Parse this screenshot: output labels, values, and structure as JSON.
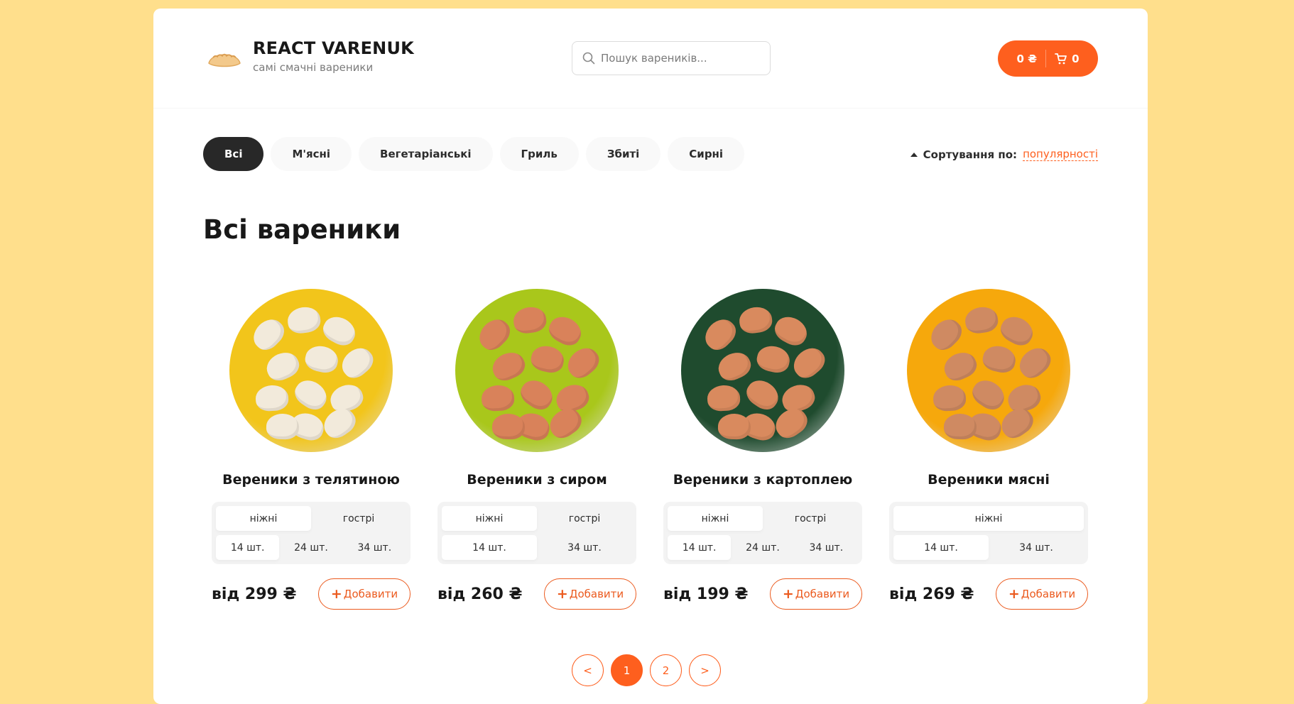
{
  "header": {
    "title": "REACT VARENUK",
    "subtitle": "самі смачні вареники",
    "search_placeholder": "Пошук вареників...",
    "cart_price": "0 ₴",
    "cart_count": "0"
  },
  "categories": [
    "Всі",
    "М'ясні",
    "Вегетаріанські",
    "Гриль",
    "Збиті",
    "Сирні"
  ],
  "active_category": "Всі",
  "sort": {
    "label": "Сортування по:",
    "value": "популярності"
  },
  "page_title": "Всі вареники",
  "products": [
    {
      "title": "Вереники з телятиною",
      "types": [
        "ніжні",
        "гострі"
      ],
      "active_type": "ніжні",
      "sizes": [
        "14 шт.",
        "24 шт.",
        "34 шт."
      ],
      "active_size": "14 шт.",
      "price": "від 299 ₴",
      "add_label": "Добавити",
      "plate_color": "#f2c51b"
    },
    {
      "title": "Вереники з сиром",
      "types": [
        "ніжні",
        "гострі"
      ],
      "active_type": "ніжні",
      "sizes": [
        "14 шт.",
        "34 шт."
      ],
      "active_size": "14 шт.",
      "price": "від 260 ₴",
      "add_label": "Добавити",
      "plate_color": "#a9c71b"
    },
    {
      "title": "Вереники з картоплею",
      "types": [
        "ніжні",
        "гострі"
      ],
      "active_type": "ніжні",
      "sizes": [
        "14 шт.",
        "24 шт.",
        "34 шт."
      ],
      "active_size": "14 шт.",
      "price": "від 199 ₴",
      "add_label": "Добавити",
      "plate_color": "#1f4b2e"
    },
    {
      "title": "Вереники мясні",
      "types": [
        "ніжні"
      ],
      "active_type": "ніжні",
      "sizes": [
        "14 шт.",
        "34 шт."
      ],
      "active_size": "14 шт.",
      "price": "від 269 ₴",
      "add_label": "Добавити",
      "plate_color": "#f6a80c"
    }
  ],
  "pagination": {
    "prev": "<",
    "pages": [
      "1",
      "2"
    ],
    "active": "1",
    "next": ">"
  },
  "colors": {
    "accent": "#fe5f1e",
    "background": "#ffdf8c",
    "dark": "#282828"
  }
}
